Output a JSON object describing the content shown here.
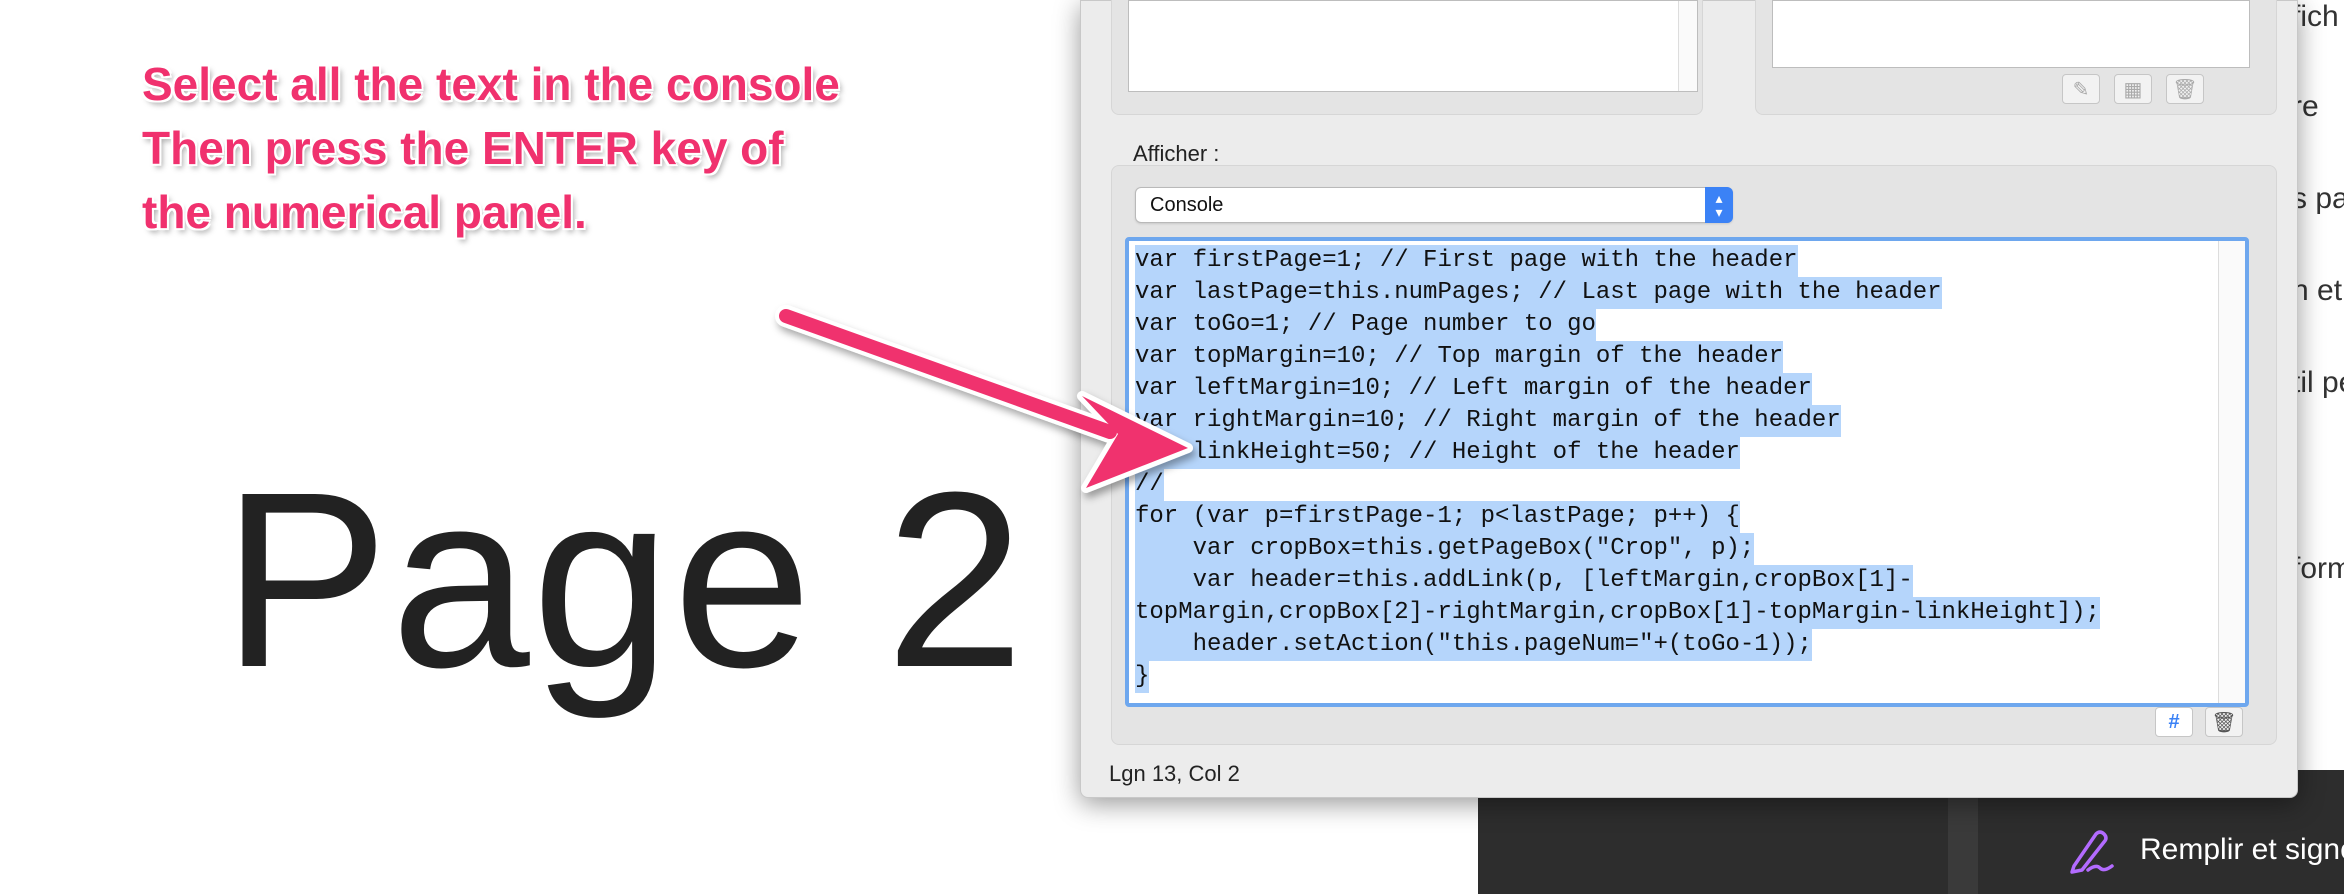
{
  "annotation": {
    "lines": [
      "Select all the text in the console",
      "Then press the ENTER key of",
      "the numerical panel."
    ],
    "color": "#f0316e"
  },
  "page_label": "Page 2",
  "dialog": {
    "show_label": "Afficher :",
    "show_select_value": "Console",
    "console_lines": [
      "var firstPage=1; // First page with the header",
      "var lastPage=this.numPages; // Last page with the header",
      "var toGo=1; // Page number to go",
      "var topMargin=10; // Top margin of the header",
      "var leftMargin=10; // Left margin of the header",
      "var rightMargin=10; // Right margin of the header",
      "var linkHeight=50; // Height of the header",
      "//",
      "for (var p=firstPage-1; p<lastPage; p++) {",
      "    var cropBox=this.getPageBox(\"Crop\", p);",
      "    var header=this.addLink(p, [leftMargin,cropBox[1]-",
      "topMargin,cropBox[2]-rightMargin,cropBox[1]-topMargin-linkHeight]);",
      "    header.setAction(\"this.pageNum=\"+(toGo-1));",
      "}"
    ],
    "status": "Lgn 13, Col 2",
    "selection_color": "#b5d5fb",
    "focus_color": "#6ea7ee"
  },
  "right_panel": {
    "texts": [
      "fich",
      "re",
      "s pa",
      "n et",
      "til pe",
      "form"
    ],
    "fill_sign_label": "Remplir et signe"
  },
  "icons": {
    "edit": "pencil-icon",
    "grid": "grid-icon",
    "trash": "trash-icon",
    "hash": "hash-icon",
    "fill_sign": "signature-icon"
  }
}
